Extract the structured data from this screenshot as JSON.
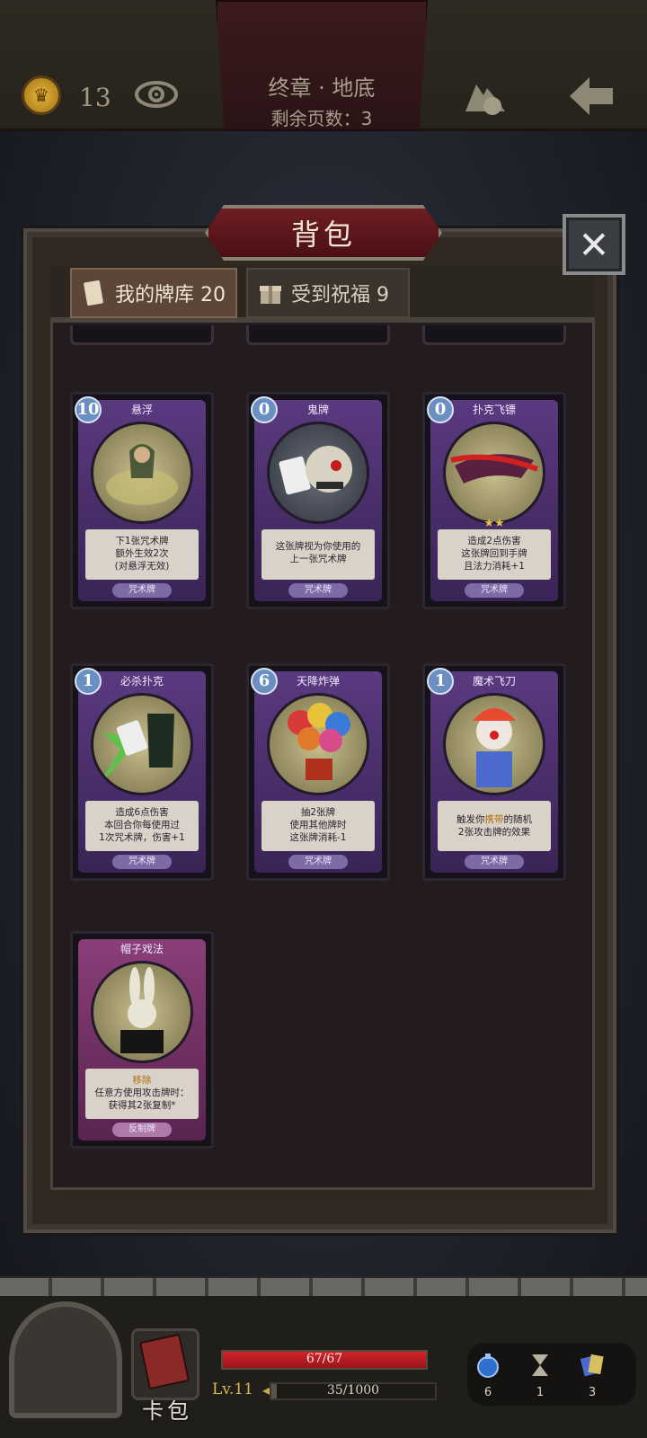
{
  "header": {
    "coin_count": "13",
    "chapter_title": "终章 · 地底",
    "pages_remaining": "剩余页数：3"
  },
  "modal": {
    "title": "背包",
    "close_symbol": "✕",
    "tabs": [
      {
        "label": "我的牌库 20",
        "active": true
      },
      {
        "label": "受到祝福 9",
        "active": false
      }
    ]
  },
  "cards": [
    {
      "name": "悬浮",
      "cost": "10",
      "desc": [
        "下1张咒术牌",
        "额外生效2次",
        "(对悬浮无效)"
      ],
      "kind": "咒术牌"
    },
    {
      "name": "鬼牌",
      "cost": "0",
      "desc": [
        "这张牌视为你使用的",
        "上一张咒术牌"
      ],
      "kind": "咒术牌"
    },
    {
      "name": "扑克飞镖",
      "cost": "0",
      "stars": "★★",
      "desc": [
        "造成2点伤害",
        "这张牌回到手牌",
        "且法力消耗+1"
      ],
      "kind": "咒术牌"
    },
    {
      "name": "必杀扑克",
      "cost": "1",
      "desc": [
        "造成6点伤害",
        "本回合你每使用过",
        "1次咒术牌，伤害+1"
      ],
      "kind": "咒术牌"
    },
    {
      "name": "天降炸弹",
      "cost": "6",
      "desc": [
        "抽2张牌",
        "使用其他牌时",
        "这张牌消耗-1"
      ],
      "kind": "咒术牌"
    },
    {
      "name": "魔术飞刀",
      "cost": "1",
      "desc_pre": "触发你",
      "desc_hl": "携带",
      "desc_post": "的随机",
      "desc2": "2张攻击牌的效果",
      "kind": "咒术牌"
    },
    {
      "name": "帽子戏法",
      "desc_hl_line": "移除",
      "desc": [
        "任意方使用攻击牌时：",
        "获得其2张复制*"
      ],
      "kind": "反制牌"
    }
  ],
  "hud": {
    "deck_label": "卡包",
    "hp_text": "67/67",
    "hp_fraction": 1.0,
    "level": "Lv.11",
    "xp_text": "35/1000",
    "xp_fraction": 0.035,
    "resources": [
      {
        "icon": "potion-icon",
        "count": "6"
      },
      {
        "icon": "hourglass-icon",
        "count": "1"
      },
      {
        "icon": "cards-icon",
        "count": "3"
      }
    ]
  },
  "colors": {
    "spell_frame": "#5a3a80",
    "counter_frame": "#8a3e78",
    "hp": "#d0242b",
    "gold": "#d9b84e"
  }
}
